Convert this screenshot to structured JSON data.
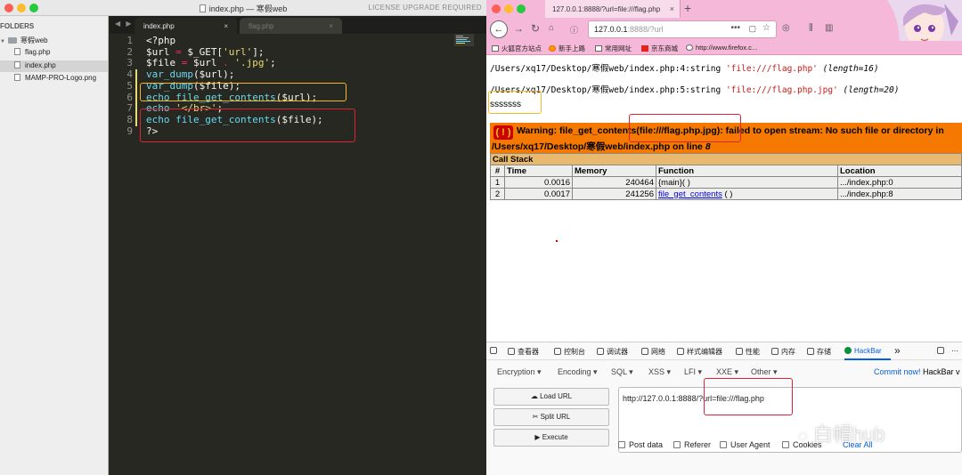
{
  "editor": {
    "title": "index.php — 寒假web",
    "license": "LICENSE UPGRADE REQUIRED",
    "tab_nav": "◀ ▶",
    "tabs": [
      {
        "label": "index.php",
        "close": "×"
      },
      {
        "label": "flag.php",
        "close": "×"
      }
    ],
    "sidebar": {
      "header": "FOLDERS",
      "folder": "寒假web",
      "files": [
        "flag.php",
        "index.php",
        "MAMP-PRO-Logo.png"
      ]
    },
    "lines": [
      {
        "num": "1",
        "parts": [
          {
            "t": "<?php",
            "c": ""
          }
        ]
      },
      {
        "num": "2",
        "parts": [
          {
            "t": "$url ",
            "c": ""
          },
          {
            "t": "=",
            "c": "o"
          },
          {
            "t": " $_GET[",
            "c": ""
          },
          {
            "t": "'url'",
            "c": "s"
          },
          {
            "t": "];",
            "c": ""
          }
        ]
      },
      {
        "num": "3",
        "parts": [
          {
            "t": "$file ",
            "c": ""
          },
          {
            "t": "=",
            "c": "o"
          },
          {
            "t": " $url ",
            "c": ""
          },
          {
            "t": ".",
            "c": "o"
          },
          {
            "t": " ",
            "c": ""
          },
          {
            "t": "'.jpg'",
            "c": "s"
          },
          {
            "t": ";",
            "c": ""
          }
        ]
      },
      {
        "num": "4",
        "parts": [
          {
            "t": "var_dump",
            "c": "k"
          },
          {
            "t": "($url);",
            "c": ""
          }
        ]
      },
      {
        "num": "5",
        "parts": [
          {
            "t": "var_dump",
            "c": "k"
          },
          {
            "t": "($file);",
            "c": ""
          }
        ]
      },
      {
        "num": "6",
        "parts": [
          {
            "t": "echo file_get_contents",
            "c": "k"
          },
          {
            "t": "($url);",
            "c": ""
          }
        ]
      },
      {
        "num": "7",
        "parts": [
          {
            "t": "echo ",
            "c": "k"
          },
          {
            "t": "'</br>'",
            "c": "s"
          },
          {
            "t": ";",
            "c": ""
          }
        ]
      },
      {
        "num": "8",
        "parts": [
          {
            "t": "echo file_get_contents",
            "c": "k"
          },
          {
            "t": "($file);",
            "c": ""
          }
        ]
      },
      {
        "num": "9",
        "parts": [
          {
            "t": "?>",
            "c": ""
          }
        ]
      }
    ]
  },
  "browser": {
    "tab_title": "127.0.0.1:8888/?url=file:///flag.php",
    "tab_close": "×",
    "new_tab": "+",
    "url_host": "127.0.0.1",
    "url_rest": ":8888/?url",
    "url_more": "•••",
    "bookmarks": [
      "火狐官方站点",
      "新手上路",
      "常用网址",
      "京东商城",
      "http://www.firefox.c..."
    ],
    "output": {
      "dump1_prefix": "/Users/xq17/Desktop/寒假web/index.php:4:string ",
      "dump1_str": "'file:///flag.php'",
      "dump1_len": "(length=16)",
      "dump2_prefix": "/Users/xq17/Desktop/寒假web/index.php:5:string ",
      "dump2_str": "'file:///flag.php.jpg'",
      "dump2_len": "(length=20)",
      "flag_content": "sssssss"
    },
    "error": {
      "icon": "( ! )",
      "line1": "Warning: file_get_contents(file:///flag.php.jpg): failed to open stream: No such file or directory in",
      "line2_text": "/Users/xq17/Desktop/寒假web/index.php on line ",
      "line2_num": "8"
    },
    "call_stack": {
      "title": "Call Stack",
      "headers": [
        "#",
        "Time",
        "Memory",
        "Function",
        "Location"
      ],
      "rows": [
        {
          "n": "1",
          "time": "0.0016",
          "mem": "240464",
          "fn": "{main}( )",
          "loc": ".../index.php:0"
        },
        {
          "n": "2",
          "time": "0.0017",
          "mem": "241256",
          "fn": "file_get_contents",
          "fn_suffix": " ( )",
          "loc": ".../index.php:8"
        }
      ]
    }
  },
  "devtools": {
    "tabs": [
      "查看器",
      "控制台",
      "调试器",
      "网络",
      "样式编辑器",
      "性能",
      "内存",
      "存储",
      "HackBar"
    ],
    "more": "»",
    "hackbar": {
      "menus": [
        "Encoding ▾",
        "Encoding ▾",
        "SQL ▾",
        "XSS ▾",
        "LFI ▾",
        "XXE ▾",
        "Other ▾"
      ],
      "menu_labels": [
        "Encryption ▾",
        "Encoding ▾",
        "SQL ▾",
        "XSS ▾",
        "LFI ▾",
        "XXE ▾",
        "Other ▾"
      ],
      "commit_link": "Commit now!",
      "commit_rest": " HackBar v",
      "load_url": "Load URL",
      "split_url": "Split URL",
      "execute": "Execute",
      "url_value": "http://127.0.0.1:8888/?url=file:///flag.php",
      "checkboxes": [
        "Post data",
        "Referer",
        "User Agent",
        "Cookies"
      ],
      "clear_all": "Clear All"
    }
  },
  "watermark": "白帽hub",
  "colors": {
    "editor_bg": "#272822",
    "keyword": "#66d9ef",
    "operator": "#f92672",
    "string": "#e6db74",
    "highlight_yellow": "#f5b823",
    "highlight_red": "#d9243a",
    "error_orange": "#f57900",
    "firefox_pink": "#f5b8d8"
  }
}
